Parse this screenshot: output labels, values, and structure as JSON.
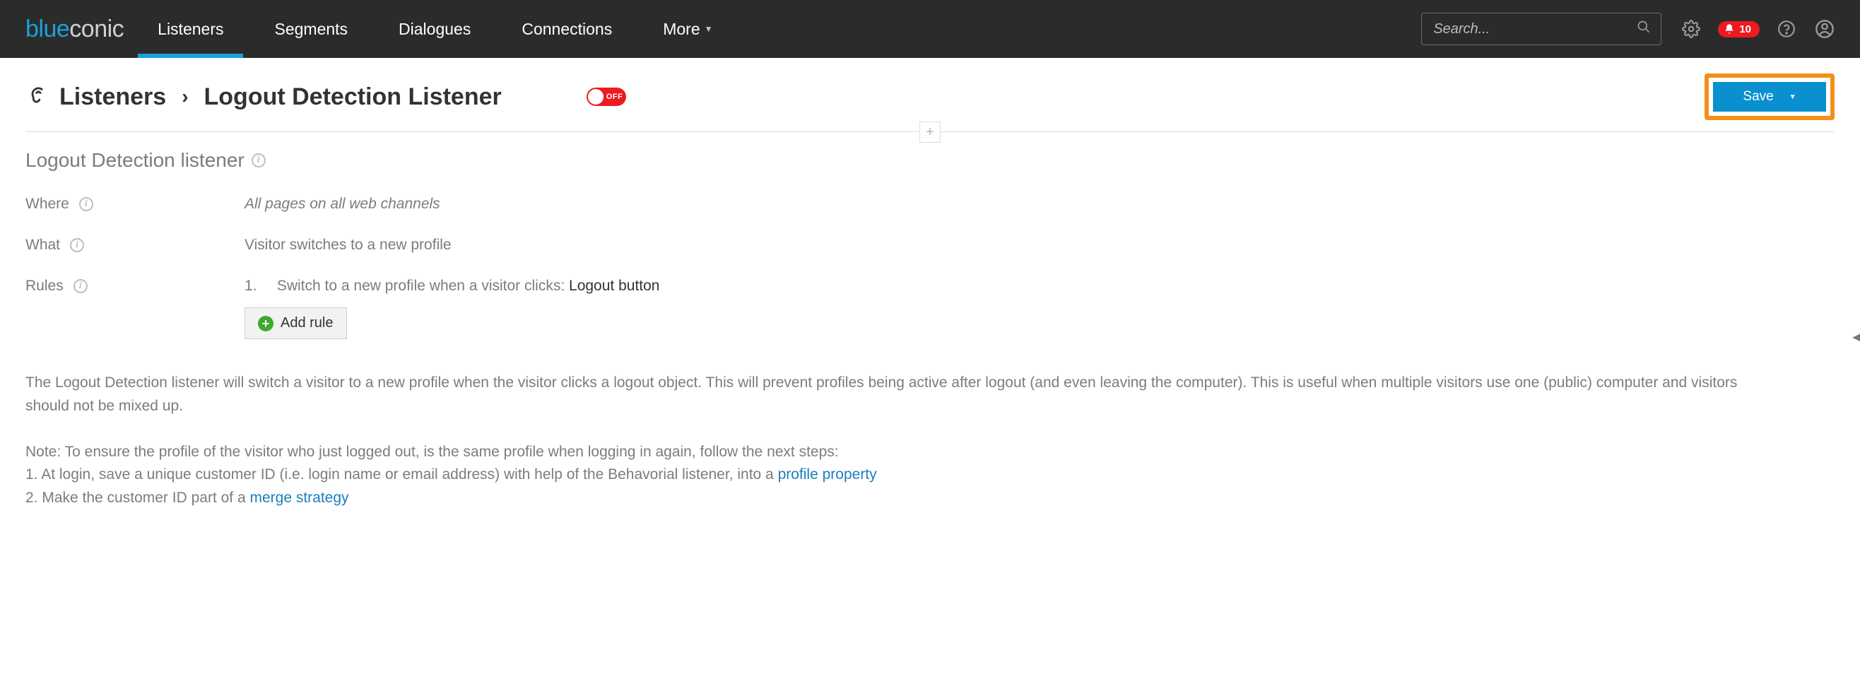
{
  "header": {
    "logo_part1": "blue",
    "logo_part2": "conic",
    "nav": [
      "Listeners",
      "Segments",
      "Dialogues",
      "Connections"
    ],
    "nav_active_index": 0,
    "more_label": "More",
    "search_placeholder": "Search...",
    "notification_count": "10"
  },
  "breadcrumb": {
    "root": "Listeners",
    "separator": "›",
    "current": "Logout Detection Listener",
    "toggle_state": "OFF",
    "save_label": "Save"
  },
  "section": {
    "title": "Logout Detection listener",
    "where_label": "Where",
    "where_value": "All pages on all web channels",
    "what_label": "What",
    "what_value": "Visitor switches to a new profile",
    "rules_label": "Rules",
    "rule1_number": "1.",
    "rule1_text_prefix": "Switch to a new profile when a visitor clicks: ",
    "rule1_target": "Logout button",
    "add_rule_label": "Add rule"
  },
  "description": {
    "para": "The Logout Detection listener will switch a visitor to a new profile when the visitor clicks a logout object. This will prevent profiles being active after logout (and even leaving the computer). This is useful when multiple visitors use one (public) computer and visitors should not be mixed up.",
    "note_intro": "Note: To ensure the profile of the visitor who just logged out, is the same profile when logging in again, follow the next steps:",
    "step1_prefix": "1. At login, save a unique customer ID (i.e. login name or email address) with help of the Behavorial listener, into a ",
    "step1_link": "profile property",
    "step2_prefix": "2. Make the customer ID part of a ",
    "step2_link": "merge strategy"
  }
}
